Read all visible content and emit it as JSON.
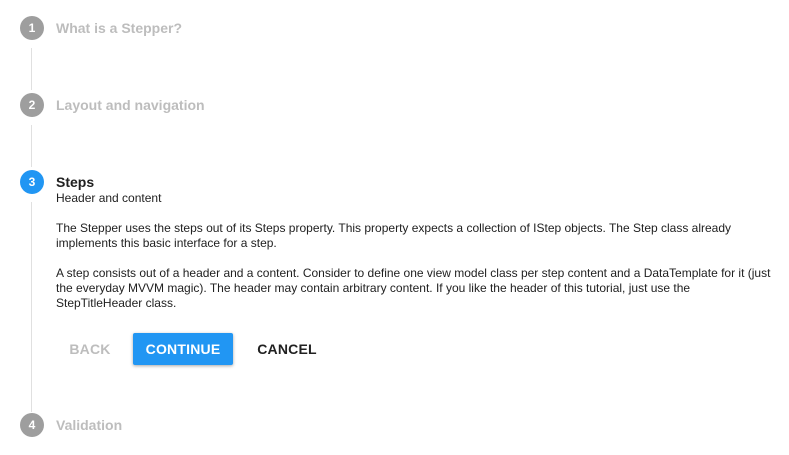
{
  "steps": [
    {
      "number": "1",
      "title": "What is a Stepper?"
    },
    {
      "number": "2",
      "title": "Layout and navigation"
    },
    {
      "number": "3",
      "title": "Steps",
      "subtitle": "Header and content",
      "paragraphs": [
        "The Stepper uses the steps out of its Steps property. This property expects a collection of IStep objects. The Step class already implements this basic interface for a step.",
        "A step consists out of a header and a content. Consider to define one view model class per step content and a DataTemplate for it (just the everyday MVVM magic). The header may contain arbitrary content. If you like the header of this tutorial, just use the StepTitleHeader class."
      ]
    },
    {
      "number": "4",
      "title": "Validation"
    }
  ],
  "buttons": {
    "back": "BACK",
    "continue": "CONTINUE",
    "cancel": "CANCEL"
  },
  "colors": {
    "accent": "#2196f3",
    "inactive_circle": "#9e9e9e",
    "inactive_text": "#bdbdbd"
  }
}
